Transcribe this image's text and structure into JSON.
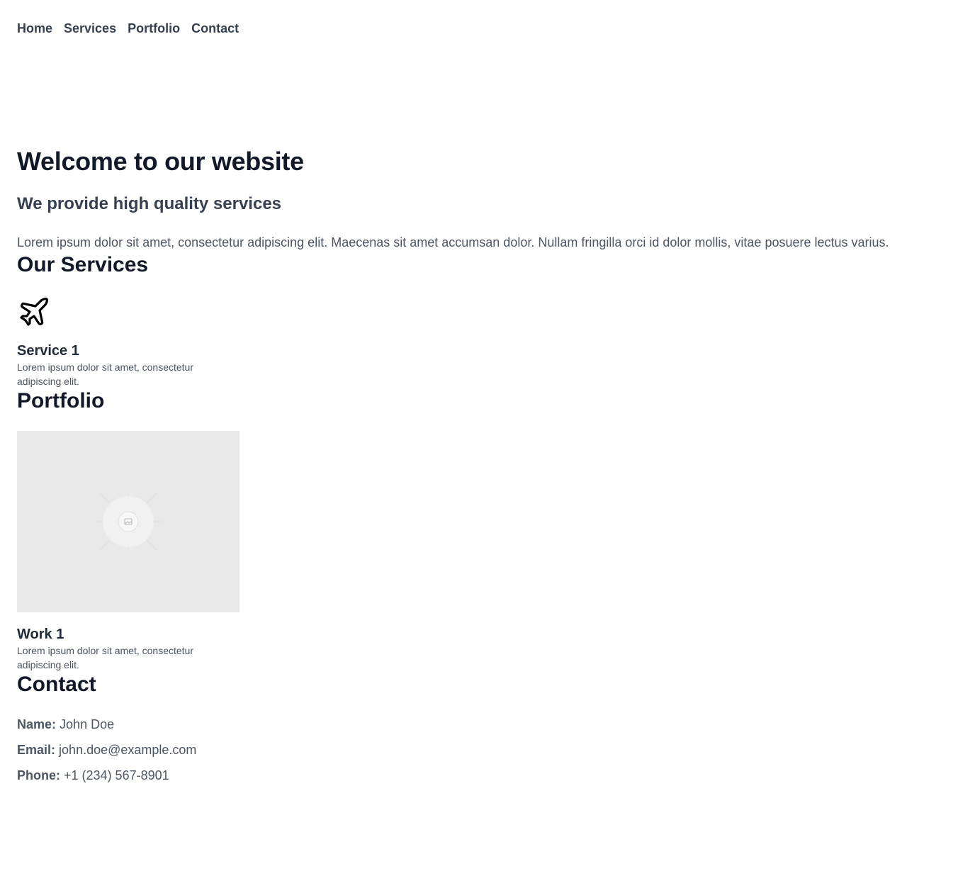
{
  "nav": {
    "items": [
      "Home",
      "Services",
      "Portfolio",
      "Contact"
    ]
  },
  "hero": {
    "title": "Welcome to our website",
    "subtitle": "We provide high quality services",
    "text": "Lorem ipsum dolor sit amet, consectetur adipiscing elit. Maecenas sit amet accumsan dolor. Nullam fringilla orci id dolor mollis, vitae posuere lectus varius."
  },
  "services": {
    "heading": "Our Services",
    "items": [
      {
        "icon": "airplane-icon",
        "title": "Service 1",
        "text": "Lorem ipsum dolor sit amet, consectetur adipiscing elit."
      }
    ]
  },
  "portfolio": {
    "heading": "Portfolio",
    "items": [
      {
        "image": "image-placeholder-icon",
        "title": "Work 1",
        "text": "Lorem ipsum dolor sit amet, consectetur adipiscing elit."
      }
    ]
  },
  "contact": {
    "heading": "Contact",
    "name_label": "Name:",
    "name_value": "John Doe",
    "email_label": "Email:",
    "email_value": "john.doe@example.com",
    "phone_label": "Phone:",
    "phone_value": "+1 (234) 567-8901"
  },
  "colors": {
    "heading": "#111827",
    "text": "#4b5563",
    "placeholder_bg": "#e9e9e9"
  }
}
